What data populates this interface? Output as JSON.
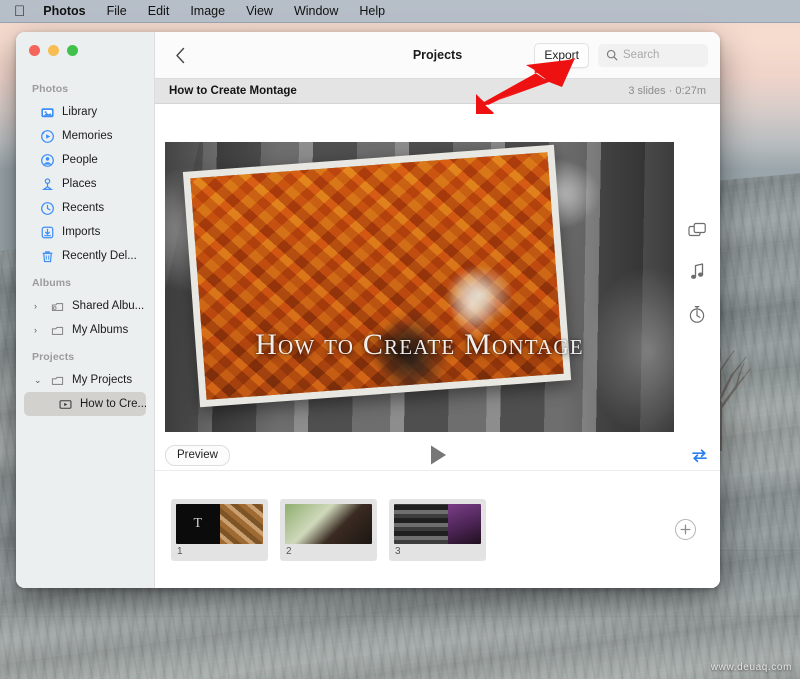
{
  "menubar": {
    "apple_icon": "apple-logo",
    "items": [
      {
        "label": "Photos",
        "bold": true
      },
      {
        "label": "File"
      },
      {
        "label": "Edit"
      },
      {
        "label": "Image"
      },
      {
        "label": "View"
      },
      {
        "label": "Window"
      },
      {
        "label": "Help"
      }
    ]
  },
  "window": {
    "traffic_lights": [
      "close",
      "minimize",
      "zoom"
    ]
  },
  "sidebar": {
    "groups": [
      {
        "title": "Photos",
        "items": [
          {
            "label": "Library",
            "icon": "library-icon"
          },
          {
            "label": "Memories",
            "icon": "memories-icon"
          },
          {
            "label": "People",
            "icon": "people-icon"
          },
          {
            "label": "Places",
            "icon": "places-icon"
          },
          {
            "label": "Recents",
            "icon": "recents-clock-icon"
          },
          {
            "label": "Imports",
            "icon": "imports-download-icon"
          },
          {
            "label": "Recently Del...",
            "icon": "trash-icon"
          }
        ]
      },
      {
        "title": "Albums",
        "items": [
          {
            "label": "Shared Albu...",
            "icon": "shared-album-icon",
            "disclosure": "›"
          },
          {
            "label": "My Albums",
            "icon": "album-folder-icon",
            "disclosure": "›"
          }
        ]
      },
      {
        "title": "Projects",
        "items": [
          {
            "label": "My Projects",
            "icon": "album-folder-icon",
            "disclosure": "⌄"
          },
          {
            "label": "How to Cre...",
            "icon": "slideshow-icon",
            "selected": true
          }
        ]
      }
    ]
  },
  "toolbar": {
    "back_icon": "chevron-left-icon",
    "title": "Projects",
    "export_label": "Export",
    "search_icon": "search-icon",
    "search_placeholder": "Search",
    "search_value": ""
  },
  "project": {
    "title": "How to Create Montage",
    "meta": "3 slides · 0:27m",
    "slide_count": 3,
    "duration": "0:27m"
  },
  "preview": {
    "overlay_title": "How to Create Montage",
    "rail_icons": [
      "slides-duplicate-icon",
      "music-note-icon",
      "timer-icon"
    ]
  },
  "transport": {
    "preview_label": "Preview",
    "play_icon": "play-icon",
    "loop_icon": "loop-repeat-icon",
    "loop_color": "#2a7ff0"
  },
  "filmstrip": {
    "slides": [
      {
        "number": "1",
        "kind": "title-and-photo",
        "title_glyph": "T"
      },
      {
        "number": "2",
        "kind": "photo"
      },
      {
        "number": "3",
        "kind": "photo-pair"
      }
    ],
    "add_label": "+",
    "add_icon": "add-circle-icon"
  },
  "annotation": {
    "arrow_color": "#ee1111",
    "arrow_target": "export-button"
  },
  "watermark": {
    "text": "www.deuaq.com"
  }
}
